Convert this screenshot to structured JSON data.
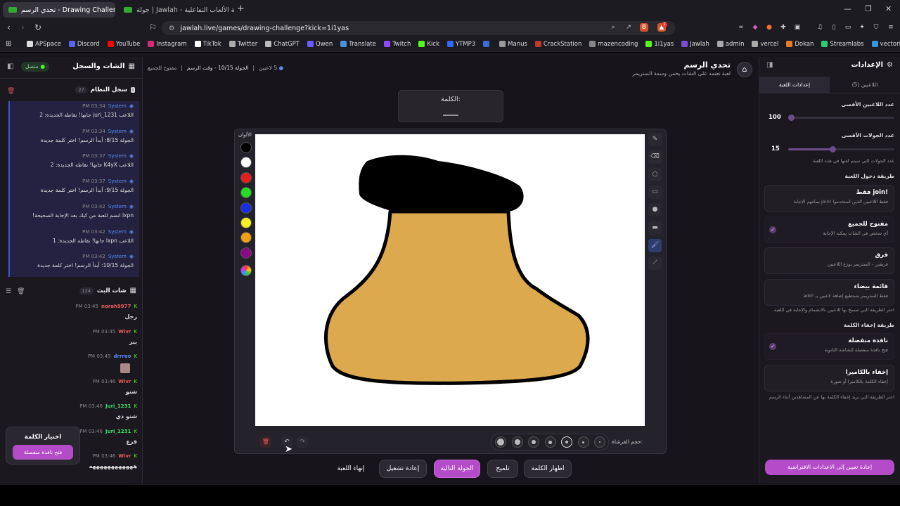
{
  "browser": {
    "tabs": [
      {
        "label": "تحدي الرسم - Drawing Challenge",
        "active": true
      },
      {
        "label": "جولة | Jawlah - منصة الألعاب التفاعلية",
        "active": false
      }
    ],
    "new_tab": "+",
    "window_controls": {
      "minimize": "—",
      "maximize": "❐",
      "close": "✕"
    },
    "url": "jawlah.live/games/drawing-challenge?kick=1i1yas",
    "bookmarks": [
      "APSpace",
      "Discord",
      "YouTube",
      "Instagram",
      "TikTok",
      "Twitter",
      "ChatGPT",
      "Qwen",
      "Translate",
      "Twitch",
      "Kick",
      "YTMP3",
      "",
      "Manus",
      "CrackStation",
      "mazencoding",
      "1i1yas",
      "Jawlah",
      "admin",
      "vercel",
      "Dokan",
      "Streamlabs",
      "vectorizer"
    ],
    "badge_count": "1"
  },
  "header": {
    "title": "تحدي الرسم",
    "subtitle": "لعبة تعتمد على الشات يخمن وسمة الستريمر",
    "status": "مفتوح للجميع",
    "round_info": "الجولة 10/15 - وقت الرسم",
    "players": "5 لاعبين"
  },
  "left": {
    "title": "الشات والسجل",
    "connection": "متصل",
    "system_log_title": "سجل النظام",
    "system_log_count": "27",
    "logs": [
      {
        "name": "System",
        "time": "03:34 PM",
        "msg": "اللاعب juri_1231 جابها! نقاطه الجديدة: 2"
      },
      {
        "name": "System",
        "time": "03:34 PM",
        "msg": "الجولة 8/15: أبدأ الرسم! اختر كلمة جديدة"
      },
      {
        "name": "System",
        "time": "03:37 PM",
        "msg": "اللاعب K4yX جابها! نقاطه الجديدة: 2"
      },
      {
        "name": "System",
        "time": "03:37 PM",
        "msg": "الجولة 9/15: أبدأ الرسم! اختر كلمة جديدة"
      },
      {
        "name": "System",
        "time": "03:42 PM",
        "msg": "lxpn انضم للعبة من كيك بعد الإجابة الصحيحة!"
      },
      {
        "name": "System",
        "time": "03:42 PM",
        "msg": "اللاعب lxpn جابها! نقاطه الجديدة: 1"
      },
      {
        "name": "System",
        "time": "03:42 PM",
        "msg": "الجولة 10/15: أبدأ الرسم! اختر كلمة جديدة"
      }
    ],
    "chat_title": "شات البث",
    "chat_count": "124",
    "chat": [
      {
        "user": "norah9977",
        "time": "03:45 PM",
        "msg": "رجل",
        "color": "#e85d5d"
      },
      {
        "user": "Wivr",
        "time": "03:45 PM",
        "msg": "بير",
        "color": "#e85d5d"
      },
      {
        "user": "drrrao",
        "time": "03:45 PM",
        "msg": "",
        "color": "#5b8cf5"
      },
      {
        "user": "Wivr",
        "time": "03:46 PM",
        "msg": "شنو",
        "color": "#e85d5d"
      },
      {
        "user": "Juri_1231",
        "time": "03:46 PM",
        "msg": "شنو ذي",
        "color": "#3ee06a"
      },
      {
        "user": "Juri_1231",
        "time": "03:46 PM",
        "msg": "قرع",
        "color": "#3ee06a"
      },
      {
        "user": "Wivr",
        "time": "03:46 PM",
        "msg": "ههههههههههههه",
        "color": "#e85d5d"
      }
    ],
    "choose_word": "اختيار الكلمة",
    "open_window": "فتح نافذة منفصلة"
  },
  "word": {
    "label": "الكلمة:",
    "value": "____"
  },
  "colors_label": "الألوان",
  "colors": [
    "#000000",
    "#ffffff",
    "#e81e1e",
    "#22dd22",
    "#1a2ee8",
    "#f5f020",
    "#f0a010",
    "#8a0a8a"
  ],
  "brush_label": "حجم الفرشاة:",
  "actions": {
    "end": "إنهاء اللعبة",
    "restart": "إعادة تشغيل",
    "next_round": "الجولة التالية",
    "hint": "تلميح",
    "show_word": "اظهار الكلمة"
  },
  "right": {
    "title": "الإعدادات",
    "tab_players": "اللاعبين (5)",
    "tab_settings": "إعدادات اللعبة",
    "max_players_label": "عدد اللاعبين الأقصى",
    "max_players": 100,
    "max_players_fraction": 0.0,
    "max_rounds_label": "عدد الجولات الأقصى",
    "max_rounds": 15,
    "max_rounds_fraction": 0.42,
    "rounds_help": "عدد الجولات التي سيتم لعبها في هذه اللعبة",
    "join_method_label": "طريقة دخول اللعبة",
    "join_options": [
      {
        "title": "!join فقط",
        "sub": "فقط اللاعبين الذين استخدموا !join يمكنهم الإجابة",
        "checked": false
      },
      {
        "title": "مفتوح للجميع",
        "sub": "أي شخص في الشات يمكنه الإجابة",
        "checked": true
      },
      {
        "title": "فرق",
        "sub": "فريقين - الستريمر يوزع اللاعبين",
        "checked": false
      },
      {
        "title": "قائمة بيضاء",
        "sub": "فقط الستريمر يستطيع إضافة لاعبين يـ !add",
        "checked": false
      }
    ],
    "join_help": "اختر الطريقة التي تسمح بها للاعبين بالانضمام والإجابة في اللعبة",
    "hide_method_label": "طريقة إخفاء الكلمة",
    "hide_options": [
      {
        "title": "نافذة منفصلة",
        "sub": "فتح نافذة منفصلة للشاشة الثانوية",
        "checked": true
      },
      {
        "title": "إخفاء بالكاميرا",
        "sub": "إخفاء الكلمة بالكاميرا أو صورة",
        "checked": false
      }
    ],
    "hide_help": "اختر الطريقة التي تريد إخفاء الكلمة بها عن المشاهدين أثناء الرسم",
    "reset_button": "إعادة تعيين إلى الاعدادات الافتراضية"
  }
}
